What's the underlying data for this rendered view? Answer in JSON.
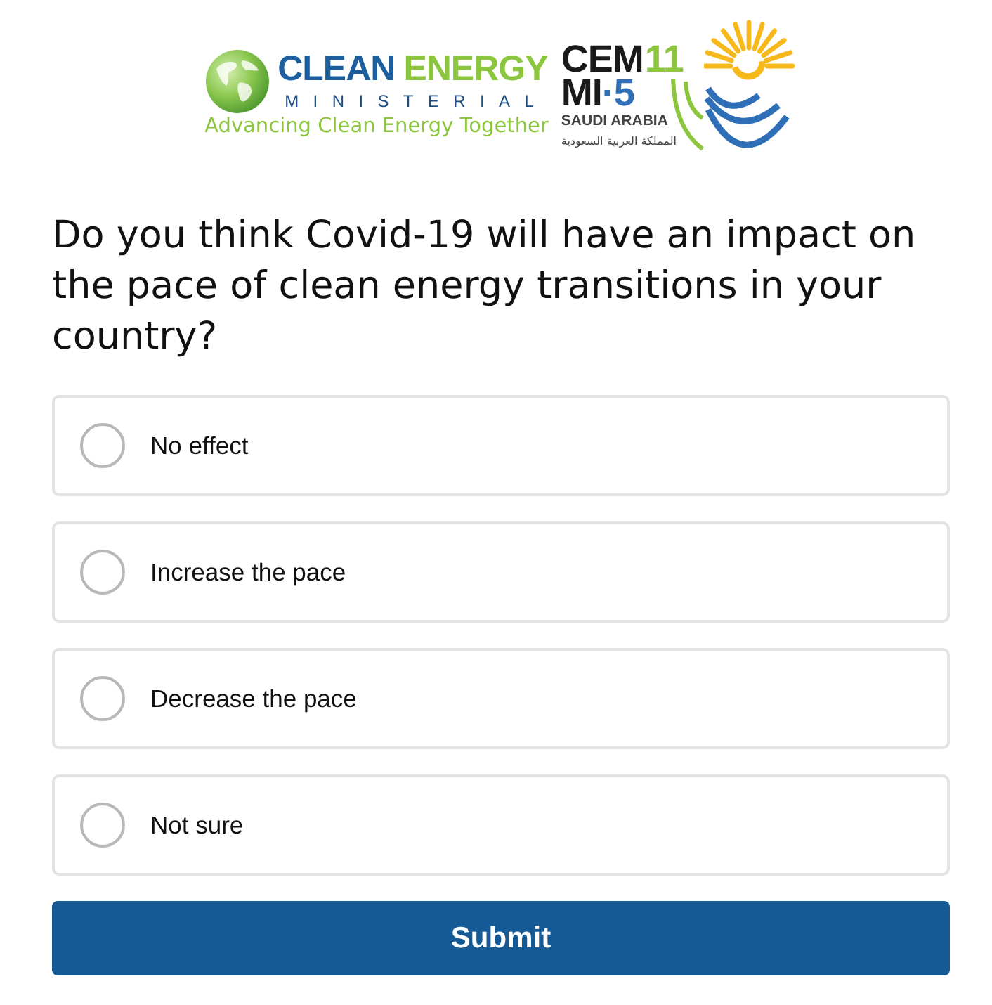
{
  "logo": {
    "ministerial": {
      "name_first": "CLEAN",
      "name_second": "ENERGY",
      "subtitle": "MINISTERIAL",
      "tagline": "Advancing Clean Energy Together"
    },
    "event": {
      "name": "CEM",
      "number": "11",
      "second_line_first": "MI",
      "second_line_second": "·5",
      "country": "SAUDI ARABIA",
      "country_arabic": "المملكة العربية السعودية"
    }
  },
  "question": "Do you think Covid-19 will have an impact on the pace of clean energy transitions in your country?",
  "options": [
    {
      "label": "No effect",
      "selected": false
    },
    {
      "label": "Increase the pace",
      "selected": false
    },
    {
      "label": "Decrease the pace",
      "selected": false
    },
    {
      "label": "Not sure",
      "selected": false
    }
  ],
  "submit": {
    "label": "Submit"
  }
}
